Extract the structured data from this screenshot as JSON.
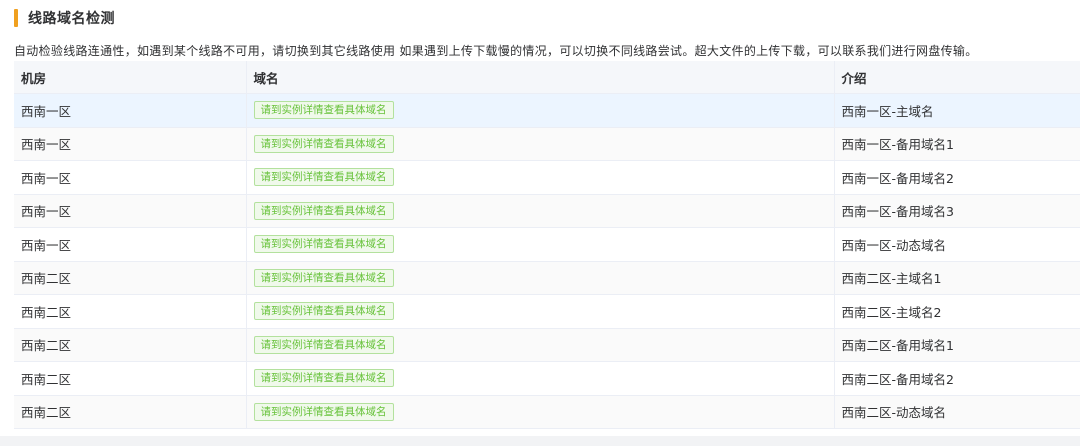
{
  "section": {
    "title": "线路域名检测",
    "description": "自动检验线路连通性，如遇到某个线路不可用，请切换到其它线路使用 如果遇到上传下载慢的情况，可以切换不同线路尝试。超大文件的上传下载，可以联系我们进行网盘传输。"
  },
  "colors": {
    "accent": "#f0a020",
    "tag_text": "#67c23a",
    "tag_bg": "#f0f9eb",
    "tag_border": "#b3e19d",
    "row_hover": "#ecf5ff"
  },
  "table": {
    "headers": [
      "机房",
      "域名",
      "介绍"
    ],
    "rows": [
      {
        "room": "西南一区",
        "domain": "请到实例详情查看具体域名",
        "intro": "西南一区-主域名"
      },
      {
        "room": "西南一区",
        "domain": "请到实例详情查看具体域名",
        "intro": "西南一区-备用域名1"
      },
      {
        "room": "西南一区",
        "domain": "请到实例详情查看具体域名",
        "intro": "西南一区-备用域名2"
      },
      {
        "room": "西南一区",
        "domain": "请到实例详情查看具体域名",
        "intro": "西南一区-备用域名3"
      },
      {
        "room": "西南一区",
        "domain": "请到实例详情查看具体域名",
        "intro": "西南一区-动态域名"
      },
      {
        "room": "西南二区",
        "domain": "请到实例详情查看具体域名",
        "intro": "西南二区-主域名1"
      },
      {
        "room": "西南二区",
        "domain": "请到实例详情查看具体域名",
        "intro": "西南二区-主域名2"
      },
      {
        "room": "西南二区",
        "domain": "请到实例详情查看具体域名",
        "intro": "西南二区-备用域名1"
      },
      {
        "room": "西南二区",
        "domain": "请到实例详情查看具体域名",
        "intro": "西南二区-备用域名2"
      },
      {
        "room": "西南二区",
        "domain": "请到实例详情查看具体域名",
        "intro": "西南二区-动态域名"
      }
    ]
  }
}
